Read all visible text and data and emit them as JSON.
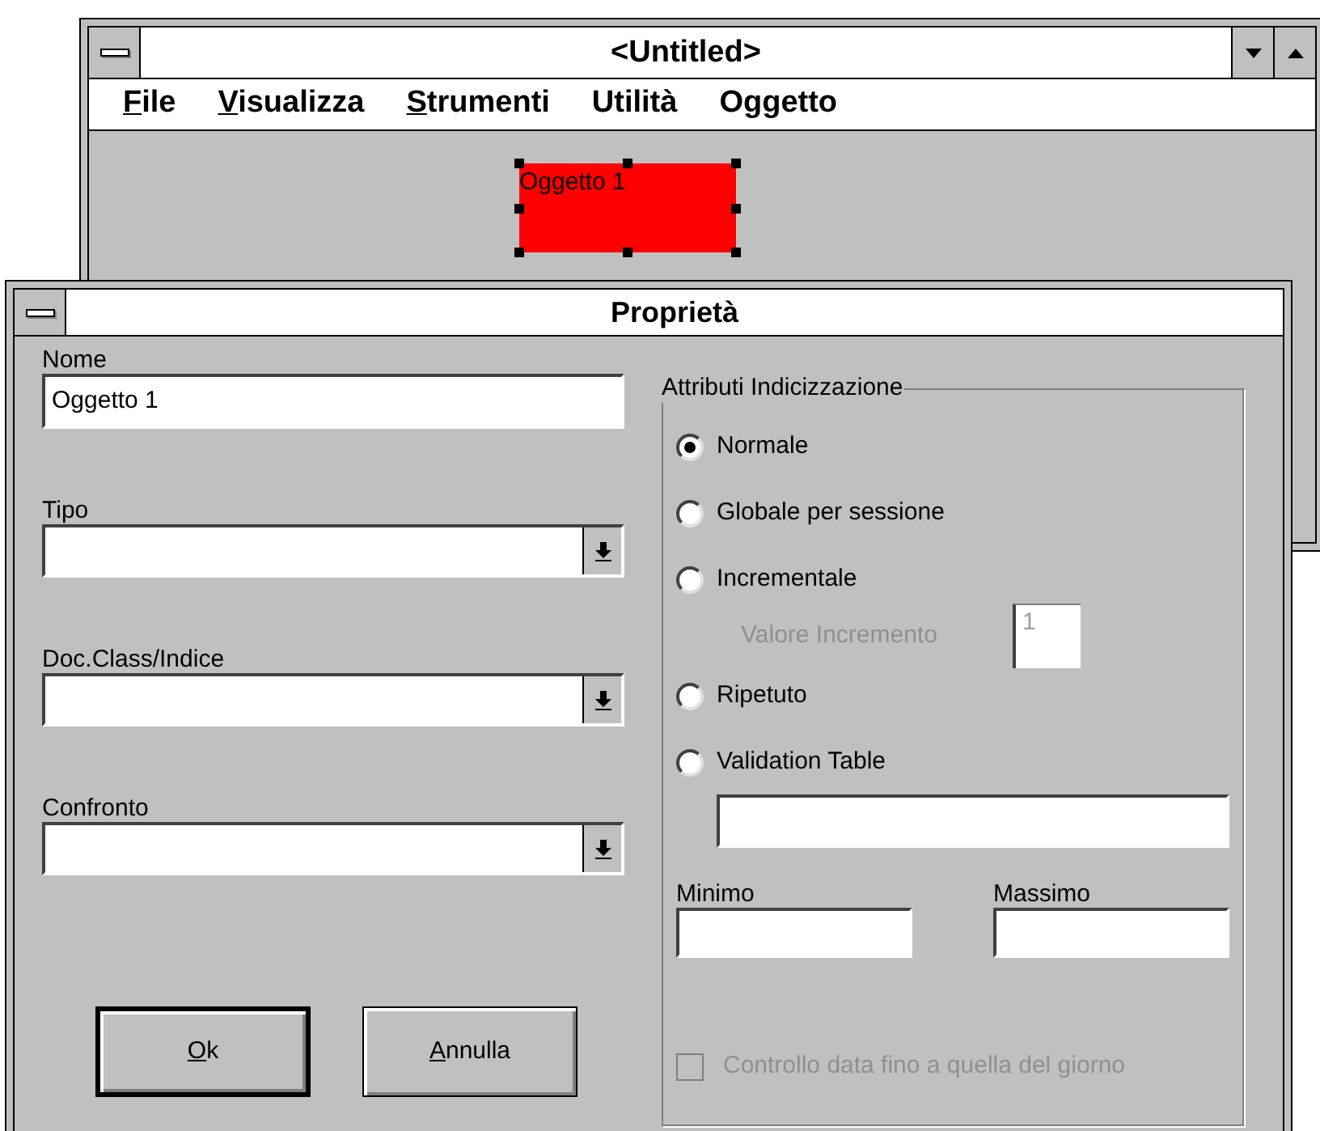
{
  "main_window": {
    "title": "<Untitled>",
    "menu": [
      {
        "label": "File",
        "mnemonic": true
      },
      {
        "label": "Visualizza",
        "mnemonic": true
      },
      {
        "label": "Strumenti",
        "mnemonic": true
      },
      {
        "label": "Utilità",
        "mnemonic": false
      },
      {
        "label": "Oggetto",
        "mnemonic": false
      }
    ],
    "canvas_objects": [
      {
        "label": "Oggetto 1",
        "color": "#ff0000",
        "selected": true
      }
    ]
  },
  "dialog": {
    "title": "Proprietà",
    "fields": [
      {
        "label": "Nome",
        "kind": "text",
        "value": "Oggetto 1"
      },
      {
        "label": "Tipo",
        "kind": "dropdown"
      },
      {
        "label": "Doc.Class/Indice",
        "kind": "dropdown"
      },
      {
        "label": "Confronto",
        "kind": "dropdown"
      }
    ],
    "buttons": [
      {
        "label": "Ok",
        "mnemonic": true,
        "default": true
      },
      {
        "label": "Annulla",
        "mnemonic": true,
        "default": false
      }
    ],
    "group": {
      "title": "Attributi Indicizzazione",
      "options": [
        {
          "label": "Normale",
          "selected": true,
          "kind": "plain"
        },
        {
          "label": "Globale per sessione",
          "selected": false,
          "kind": "plain"
        },
        {
          "label": "Incrementale",
          "selected": false,
          "kind": "with_value",
          "sub": {
            "label": "Valore Incremento",
            "value": "1",
            "disabled": true
          }
        },
        {
          "label": "Ripetuto",
          "selected": false,
          "kind": "plain"
        },
        {
          "label": "Validation Table",
          "selected": false,
          "kind": "with_field"
        }
      ],
      "ranges": [
        {
          "label": "Minimo"
        },
        {
          "label": "Massimo"
        }
      ],
      "checkbox": {
        "label": "Controllo data fino a quella del giorno",
        "checked": false,
        "disabled": true
      }
    }
  }
}
